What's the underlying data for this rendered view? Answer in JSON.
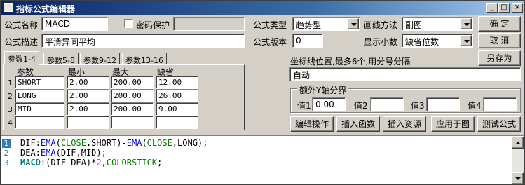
{
  "window": {
    "title": "指标公式编辑器",
    "minimize_glyph": "_",
    "maximize_glyph": "□",
    "close_glyph": "×"
  },
  "form": {
    "name_label": "公式名称",
    "name_value": "MACD",
    "password_label": "密码保护",
    "password_checked": false,
    "desc_label": "公式描述",
    "desc_value": "平滑异同平均",
    "type_label": "公式类型",
    "type_value": "趋势型",
    "version_label": "公式版本",
    "version_value": "0",
    "drawmode_label": "画线方法",
    "drawmode_value": "副图",
    "decimals_label": "显示小数",
    "decimals_value": "缺省位数"
  },
  "buttons": {
    "ok": "确 定",
    "cancel": "取 消",
    "save_as": "另存为",
    "edit_ops": "编辑操作",
    "insert_func": "插入函数",
    "insert_res": "插入资源",
    "apply_chart": "应用于图",
    "test_formula": "测试公式"
  },
  "tabs": [
    "参数1-4",
    "参数5-8",
    "参数9-12",
    "参数13-16"
  ],
  "params": {
    "headers": [
      "参数",
      "最小",
      "最大",
      "缺省"
    ],
    "rows": [
      {
        "num": "1",
        "name": "SHORT",
        "min": "2.00",
        "max": "200.00",
        "def": "12.00"
      },
      {
        "num": "2",
        "name": "LONG",
        "min": "2.00",
        "max": "200.00",
        "def": "26.00"
      },
      {
        "num": "3",
        "name": "MID",
        "min": "2.00",
        "max": "200.00",
        "def": "9.00"
      },
      {
        "num": "4",
        "name": "",
        "min": "",
        "max": "",
        "def": ""
      }
    ]
  },
  "axis": {
    "label": "坐标线位置,最多6个,用分号分隔",
    "value": "自动"
  },
  "extra_y": {
    "title": "额外Y轴分界",
    "labels": [
      "值1",
      "值2",
      "值3",
      "值4"
    ],
    "values": [
      "0.00",
      "",
      "",
      ""
    ]
  },
  "code": {
    "line_numbers": [
      "1",
      "2",
      "3"
    ]
  }
}
